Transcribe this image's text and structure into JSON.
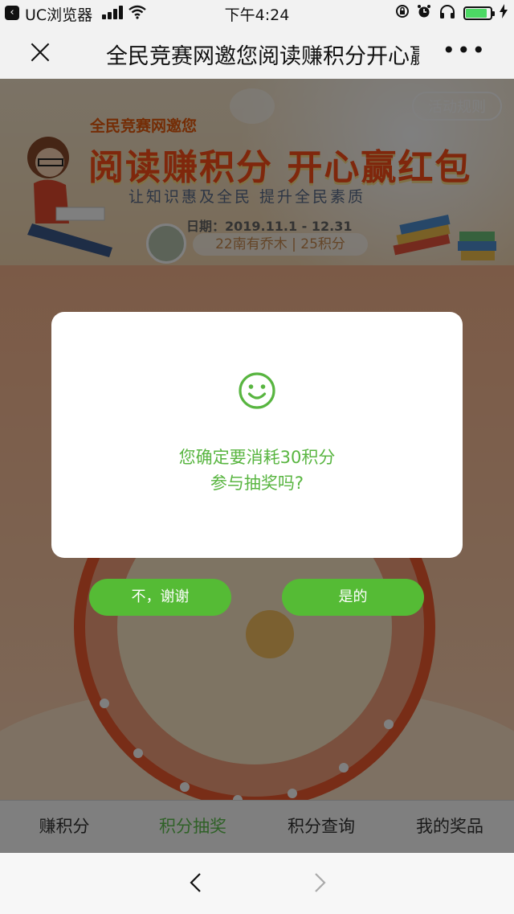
{
  "status_bar": {
    "app_name": "UC浏览器",
    "time": "下午4:24",
    "battery_level": 0.85
  },
  "nav": {
    "title": "全民竞赛网邀您阅读赚积分开心赢红包",
    "more_label": "•••"
  },
  "banner": {
    "rules_label": "活动规则",
    "subtitle": "全民竞赛网邀您",
    "title": "阅读赚积分 开心赢红包",
    "slogan": "让知识惠及全民 提升全民素质",
    "date": "日期：2019.11.1 - 12.31",
    "user_line": "22南有乔木 | 25积分"
  },
  "modal": {
    "message_line1": "您确定要消耗30积分",
    "message_line2": "参与抽奖吗?",
    "icon": "smile-icon",
    "accent_color": "#55bb35"
  },
  "buttons": {
    "cancel": "不，谢谢",
    "confirm": "是的"
  },
  "tabs": [
    {
      "label": "赚积分",
      "active": false
    },
    {
      "label": "积分抽奖",
      "active": true
    },
    {
      "label": "积分查询",
      "active": false
    },
    {
      "label": "我的奖品",
      "active": false
    }
  ],
  "browser": {
    "back_icon": "chevron-left-icon",
    "forward_icon": "chevron-right-icon"
  }
}
